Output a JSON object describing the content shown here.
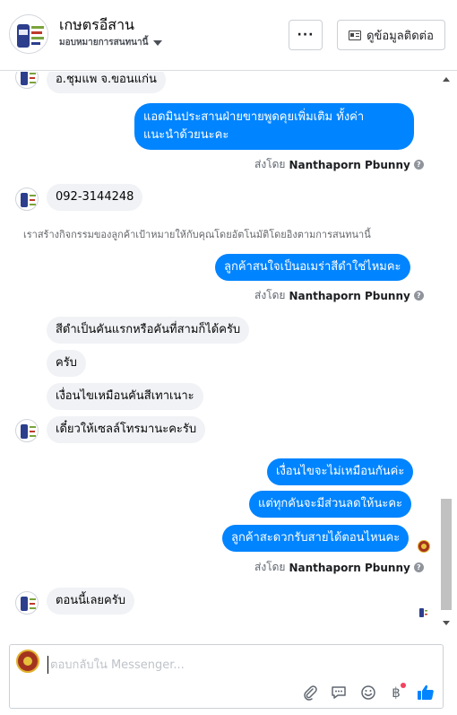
{
  "header": {
    "page_name": "เกษตรอีสาน",
    "assign_label": "มอบหมายการสนทนานี้",
    "more_label": "···",
    "contact_label": "ดูข้อมูลติดต่อ"
  },
  "thread": {
    "messages": [
      {
        "dir": "in",
        "text": "อ.ชุมแพ จ.ขอนแก่น"
      },
      {
        "dir": "out",
        "lines": [
          "แอดมินประสานฝ่ายขายพูดคุยเพิ่มเติม ทั้งค่า",
          "แนะนำด้วยนะคะ"
        ]
      },
      {
        "dir": "in",
        "text": "092-3144248"
      },
      {
        "dir": "out",
        "text": "ลูกค้าสนใจเป็นอเมร่าสีดำใช่ไหมคะ"
      },
      {
        "dir": "in",
        "text": "สีดำเป็นคันแรกหรือคันที่สามก็ได้ครับ"
      },
      {
        "dir": "in",
        "text": "ครับ"
      },
      {
        "dir": "in",
        "text": "เงื่อนไขเหมือนคันสีเทาเนาะ"
      },
      {
        "dir": "in",
        "text": "เดี๋ยวให้เซลล์โทรมานะคะรับ"
      },
      {
        "dir": "out",
        "text": "เงื่อนไขจะไม่เหมือนกันค่ะ"
      },
      {
        "dir": "out",
        "text": "แต่ทุกคันจะมีส่วนลดให้นะคะ"
      },
      {
        "dir": "out",
        "text": "ลูกค้าสะดวกรับสายได้ตอนไหนคะ"
      },
      {
        "dir": "in",
        "text": "ตอนนี้เลยครับ"
      }
    ],
    "sent_by_prefix": "ส่งโดย",
    "sent_by_name": "Nanthaporn Pbunny",
    "help_glyph": "?",
    "notice": "เราสร้างกิจกรรมของลูกค้าเป้าหมายให้กับคุณโดยอัตโนมัติโดยอิงตามการสนทนานี้"
  },
  "composer": {
    "placeholder": "ตอบกลับใน Messenger...",
    "currency_glyph": "฿"
  },
  "colors": {
    "outgoing_bubble": "#0084ff",
    "incoming_bubble": "#f0f2f5",
    "like_button": "#0084ff"
  },
  "icons": [
    "page-logo-icon",
    "ellipsis-icon",
    "contact-card-icon",
    "attachment-icon",
    "sticker-icon",
    "emoji-icon",
    "currency-icon",
    "thumbs-up-icon",
    "help-icon"
  ]
}
